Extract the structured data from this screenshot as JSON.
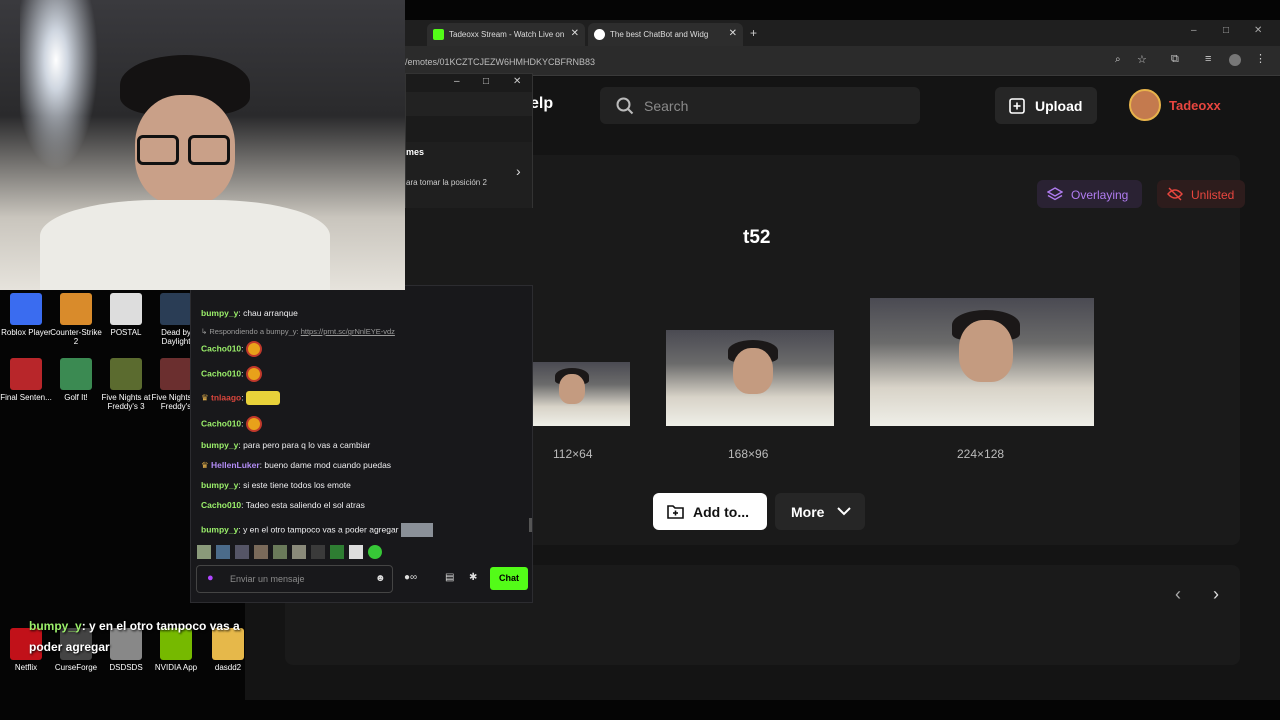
{
  "browser": {
    "tabs": [
      {
        "label": "Tadeoxx Stream - Watch Live on",
        "icon": "kick-icon"
      },
      {
        "label": "The best ChatBot and Widg",
        "icon": "botrix-icon"
      }
    ],
    "url": "/emotes/01KCZTCJEZW6HMHDKYCBFRNB83",
    "window_controls": [
      "–",
      "□",
      "✕"
    ]
  },
  "site": {
    "nav_partial": "elp",
    "search_placeholder": "Search",
    "upload_label": "Upload",
    "username": "Tadeoxx"
  },
  "emote": {
    "name": "t52",
    "tags": [
      {
        "label": "Overlaying",
        "color": "#b07cf0"
      },
      {
        "label": "Unlisted",
        "color": "#e8463f"
      }
    ],
    "sizes": [
      "112×64",
      "168×96",
      "224×128"
    ],
    "add_label": "Add to...",
    "more_label": "More"
  },
  "overlay_window": {
    "title_partial": "mes",
    "subtitle_partial": "ara tomar la posición 2"
  },
  "chat": {
    "messages": [
      {
        "user": "bumpy_y",
        "text": "chau arranque",
        "color": "#9bf06b"
      },
      {
        "reply": "Respondiendo a bumpy_y:",
        "link": "https://prnt.sc/grNnlEYE-vdz"
      },
      {
        "user": "Cacho010",
        "text": "",
        "color": "#9bf06b",
        "emote": true
      },
      {
        "user": "Cacho010",
        "text": "",
        "color": "#9bf06b",
        "emote": true
      },
      {
        "user": "tnlaago",
        "text": "",
        "color": "#d9453c",
        "emote": true
      },
      {
        "user": "Cacho010",
        "text": "",
        "color": "#9bf06b",
        "emote": true
      },
      {
        "user": "bumpy_y",
        "text": "para pero para q lo vas a cambiar",
        "color": "#9bf06b"
      },
      {
        "user": "HellenLuker",
        "text": "bueno dame mod cuando puedas",
        "color": "#b28cf5"
      },
      {
        "user": "bumpy_y",
        "text": "si este tiene todos los emote",
        "color": "#9bf06b"
      },
      {
        "user": "Cacho010",
        "text": "Tadeo esta saliendo el sol atras",
        "color": "#9bf06b"
      },
      {
        "user": "bumpy_y",
        "text": "y en el otro tampoco vas a poder agregar",
        "color": "#9bf06b"
      }
    ],
    "input_placeholder": "Enviar un mensaje",
    "send_label": "Chat"
  },
  "desktop_icons": [
    {
      "label": "Roblox Player",
      "color": "#3a6cf0"
    },
    {
      "label": "Counter-Strike 2",
      "color": "#d98b2b"
    },
    {
      "label": "POSTAL",
      "color": "#ddd"
    },
    {
      "label": "Dead by Daylight",
      "color": "#2a3d55"
    },
    {
      "label": "Final Senten...",
      "color": "#b8262a"
    },
    {
      "label": "Golf It!",
      "color": "#3b8a52"
    },
    {
      "label": "Five Nights at Freddy's 3",
      "color": "#5b6b2f"
    },
    {
      "label": "Five Nights at Freddy's",
      "color": "#6b2f2f"
    },
    {
      "label": "Netflix",
      "color": "#c11119"
    },
    {
      "label": "CurseForge",
      "color": "#444"
    },
    {
      "label": "DSDSDS",
      "color": "#888"
    },
    {
      "label": "NVIDIA App",
      "color": "#76b900"
    },
    {
      "label": "dasdd2",
      "color": "#e6b84a"
    }
  ],
  "stream_overlay": {
    "user": "bumpy_y",
    "text": ": y en el otro tampoco vas a poder agregar"
  }
}
